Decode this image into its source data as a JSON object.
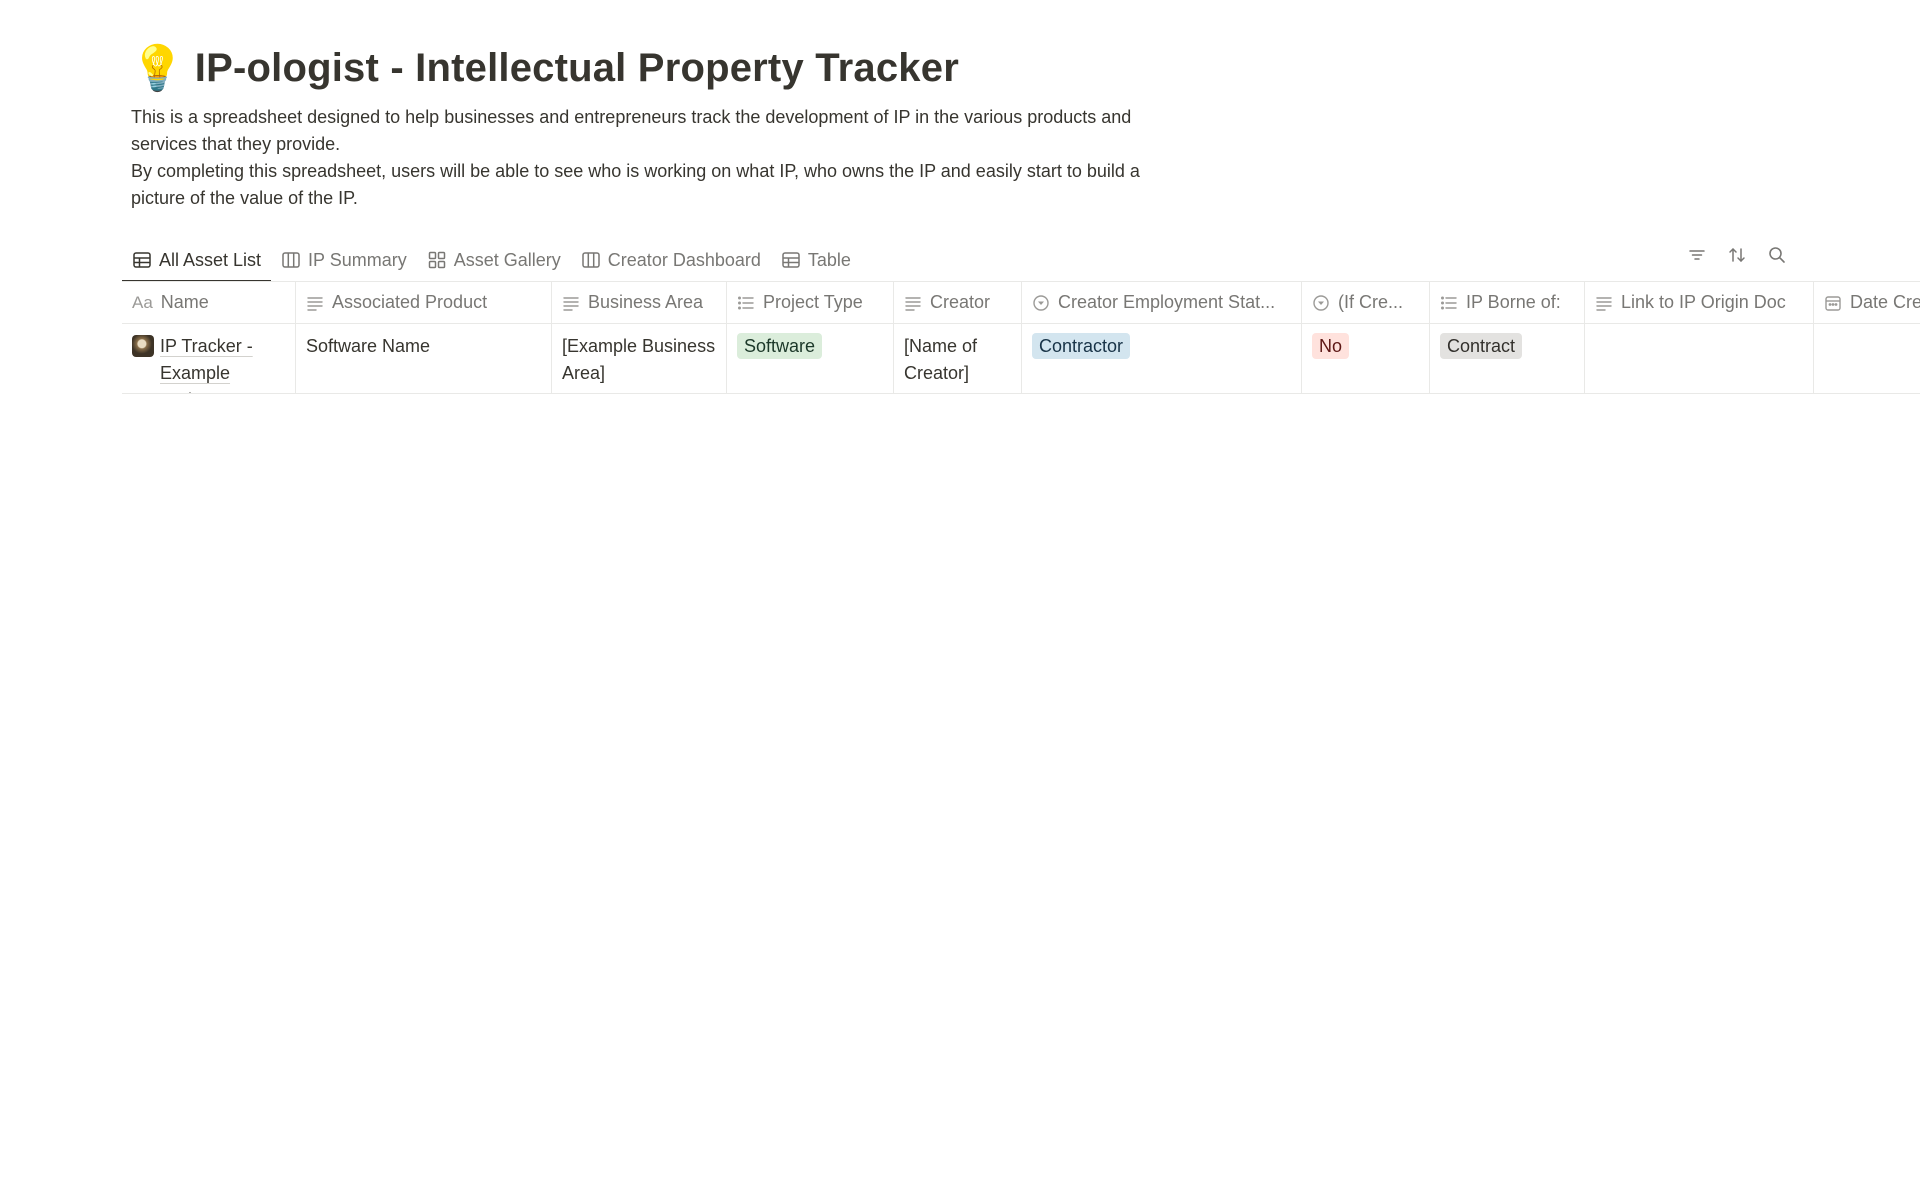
{
  "header": {
    "emoji": "💡",
    "title": "IP-ologist - Intellectual Property Tracker",
    "description_1": "This is a spreadsheet designed to help businesses and entrepreneurs track the development of IP in the various products and services that they provide.",
    "description_2": "By completing this spreadsheet, users will be able to see who is working on what IP, who owns the IP and easily start to build a picture of the value of the IP."
  },
  "tabs": [
    {
      "label": "All Asset List",
      "icon": "table-icon",
      "active": true
    },
    {
      "label": "IP Summary",
      "icon": "board-icon",
      "active": false
    },
    {
      "label": "Asset Gallery",
      "icon": "gallery-icon",
      "active": false
    },
    {
      "label": "Creator Dashboard",
      "icon": "board-icon",
      "active": false
    },
    {
      "label": "Table",
      "icon": "table-icon",
      "active": false
    }
  ],
  "toolbar": {
    "icons": [
      "filter-icon",
      "sort-icon",
      "search-icon"
    ]
  },
  "table": {
    "columns": [
      {
        "label": "Name",
        "icon": "title-aa",
        "icon_text": "Aa"
      },
      {
        "label": "Associated Product",
        "icon": "text-icon"
      },
      {
        "label": "Business Area",
        "icon": "text-icon"
      },
      {
        "label": "Project Type",
        "icon": "multiselect-icon"
      },
      {
        "label": "Creator",
        "icon": "text-icon"
      },
      {
        "label": "Creator Employment Stat...",
        "icon": "select-icon"
      },
      {
        "label": "(If Cre...",
        "icon": "select-icon"
      },
      {
        "label": "IP Borne of:",
        "icon": "multiselect-icon"
      },
      {
        "label": "Link to IP Origin Doc",
        "icon": "text-icon"
      },
      {
        "label": "Date Cre",
        "icon": "calendar-icon"
      }
    ],
    "rows": [
      {
        "name": "IP Tracker - Example Project",
        "associated_product": "Software Name",
        "business_area": "[Example Business Area]",
        "project_type": "Software",
        "creator": "[Name of Creator]",
        "employment_status": "Contractor",
        "if_creator": "No",
        "ip_borne_of": "Contract",
        "link": "",
        "date": ""
      }
    ]
  },
  "colors": {
    "tag_green_bg": "#dbeddb",
    "tag_green_fg": "#1c3829",
    "tag_blue_bg": "#d3e5ef",
    "tag_blue_fg": "#183347",
    "tag_red_bg": "#ffe2dd",
    "tag_red_fg": "#5d1715",
    "tag_gray_bg": "#e3e2e0",
    "tag_gray_fg": "#32302c"
  }
}
